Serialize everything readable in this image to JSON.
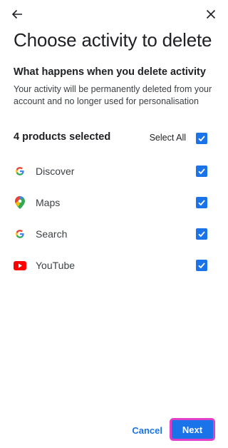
{
  "header": {
    "back_icon": "arrow-back-icon",
    "close_icon": "close-icon"
  },
  "title": "Choose activity to delete",
  "info": {
    "heading": "What happens when you delete activity",
    "description": "Your activity will be permanently deleted from your account and no longer used for personalisation"
  },
  "summary": {
    "count_text": "4 products selected",
    "select_all_label": "Select All",
    "select_all_checked": true
  },
  "products": [
    {
      "label": "Discover",
      "icon": "google-g-icon",
      "checked": true
    },
    {
      "label": "Maps",
      "icon": "google-maps-pin-icon",
      "checked": true
    },
    {
      "label": "Search",
      "icon": "google-g-icon",
      "checked": true
    },
    {
      "label": "YouTube",
      "icon": "youtube-icon",
      "checked": true
    }
  ],
  "footer": {
    "cancel_label": "Cancel",
    "next_label": "Next"
  },
  "colors": {
    "accent": "#1a73e8",
    "highlight": "#e040c8"
  }
}
